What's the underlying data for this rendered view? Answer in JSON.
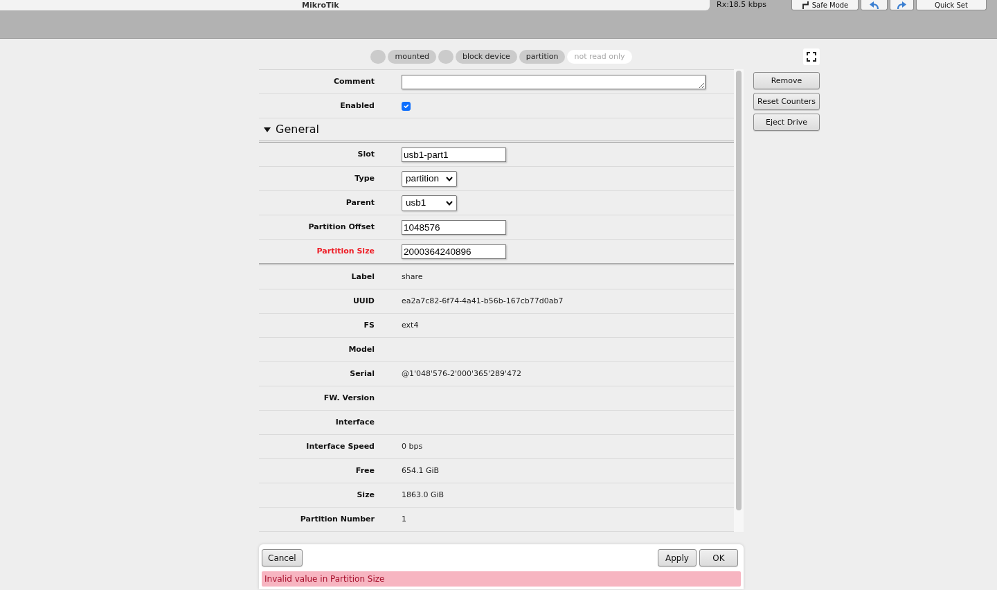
{
  "header": {
    "brand": "MikroTik",
    "rx_rate": "Rx:18.5 kbps",
    "buttons": [
      {
        "kind": "safe_mode",
        "label": "Safe Mode"
      },
      {
        "kind": "undo"
      },
      {
        "kind": "redo"
      },
      {
        "kind": "text",
        "label": "Quick Set"
      }
    ]
  },
  "status_flags": [
    {
      "kind": "dot",
      "on": true
    },
    {
      "kind": "pill",
      "label": "mounted",
      "on": true
    },
    {
      "kind": "dot",
      "on": true
    },
    {
      "kind": "pill",
      "label": "block device",
      "on": true
    },
    {
      "kind": "pill",
      "label": "partition",
      "on": true
    },
    {
      "kind": "pill",
      "label": "not read only",
      "on": false
    }
  ],
  "form": {
    "fields": [
      {
        "kind": "textarea",
        "label": "Comment"
      },
      {
        "kind": "checkbox",
        "label": "Enabled",
        "checked": true
      }
    ],
    "section": {
      "title": "General",
      "expanded": true,
      "fields": [
        {
          "kind": "input",
          "label": "Slot",
          "value": "usb1-part1",
          "invalid": false
        },
        {
          "kind": "select",
          "label": "Type",
          "value": "partition",
          "invalid": false
        },
        {
          "kind": "select",
          "label": "Parent",
          "value": "usb1",
          "invalid": false
        },
        {
          "kind": "input",
          "label": "Partition Offset",
          "value": "1048576",
          "invalid": false
        },
        {
          "kind": "input",
          "label": "Partition Size",
          "value": "2000364240896",
          "invalid": true
        }
      ]
    },
    "status": [
      {
        "label": "Label",
        "value": "share"
      },
      {
        "label": "UUID",
        "value": "ea2a7c82-6f74-4a41-b56b-167cb77d0ab7"
      },
      {
        "label": "FS",
        "value": "ext4"
      },
      {
        "label": "Model"
      },
      {
        "label": "Serial",
        "value": "@1'048'576-2'000'365'289'472"
      },
      {
        "label": "FW. Version"
      },
      {
        "label": "Interface"
      },
      {
        "label": "Interface Speed",
        "value": "0 bps"
      },
      {
        "label": "Free",
        "value": "654.1 GiB"
      },
      {
        "label": "Size",
        "value": "1863.0 GiB"
      },
      {
        "label": "Partition Number",
        "value": "1"
      }
    ]
  },
  "side_buttons": [
    "Remove",
    "Reset Counters",
    "Eject Drive"
  ],
  "footer": {
    "left_buttons": [
      "Cancel"
    ],
    "right_buttons": [
      "Apply",
      "OK"
    ],
    "error": "Invalid value in Partition Size"
  }
}
